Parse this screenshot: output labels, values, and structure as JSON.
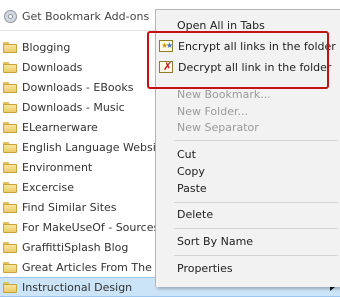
{
  "top": {
    "label": "Get Bookmark Add-ons"
  },
  "bookmarks": [
    {
      "label": "Blogging"
    },
    {
      "label": "Downloads"
    },
    {
      "label": "Downloads - EBooks"
    },
    {
      "label": "Downloads - Music"
    },
    {
      "label": "ELearnerware"
    },
    {
      "label": "English Language Websites"
    },
    {
      "label": "Environment"
    },
    {
      "label": "Excercise"
    },
    {
      "label": "Find Similar Sites"
    },
    {
      "label": "For MakeUseOf - Sources"
    },
    {
      "label": "GraffittiSplash Blog"
    },
    {
      "label": "Great Articles From The Web"
    },
    {
      "label": "Instructional Design"
    }
  ],
  "context_menu": {
    "open_all_tabs": "Open All in Tabs",
    "encrypt": "Encrypt all links in the folder",
    "decrypt": "Decrypt all link in the folder",
    "new_bookmark": "New Bookmark...",
    "new_folder": "New Folder...",
    "new_separator": "New Separator",
    "cut": "Cut",
    "copy": "Copy",
    "paste": "Paste",
    "delete": "Delete",
    "sort": "Sort By Name",
    "properties": "Properties"
  },
  "icons": {
    "top": "add-ons-gear-icon",
    "folder": "folder-icon",
    "encrypt": "encrypt-lock-icon",
    "decrypt": "decrypt-icon",
    "submenu": "submenu-arrow-icon"
  },
  "colors": {
    "highlight_border": "#c41111",
    "selected_row": "#cce4f7",
    "menu_bg": "#f2f2f2"
  }
}
